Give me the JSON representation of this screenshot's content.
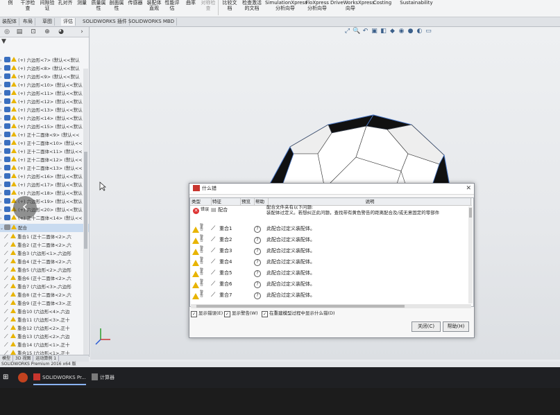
{
  "ribbon": {
    "items": [
      "例",
      "干涉检\n查",
      "间隙验\n证",
      "孔对齐",
      "测量",
      "质量属\n性",
      "剖面属\n性",
      "传感器",
      "装配体\n直观",
      "性能评\n估",
      "曲率",
      "对称检\n查",
      "比较文\n档",
      "检查激活\n的文档",
      "SimulationXpress\n分析向导",
      "FloXpress\n分析向导",
      "DriveWorksXpress\n向导",
      "Costing",
      "Sustainability"
    ]
  },
  "tabs": [
    "装配体",
    "布局",
    "草图",
    "评估",
    "SOLIDWORKS 插件",
    "SOLIDWORKS MBD"
  ],
  "active_tab": "评估",
  "tree": {
    "filter_icon": "filter-icon",
    "rows": [
      "(+) 六边形<7> (默认<<默认",
      "(+) 六边形<8> (默认<<默认",
      "(+) 六边形<9> (默认<<默认",
      "(+) 六边形<10> (默认<<默认",
      "(+) 六边形<11> (默认<<默认",
      "(+) 六边形<12> (默认<<默认",
      "(+) 六边形<13> (默认<<默认",
      "(+) 六边形<14> (默认<<默认",
      "(+) 六边形<15> (默认<<默认",
      "(+) 正十二面体<9> (默认<<",
      "(+) 正十二面体<10> (默认<<",
      "(+) 正十二面体<11> (默认<<",
      "(+) 正十二面体<12> (默认<<",
      "(+) 正十二面体<13> (默认<<",
      "(+) 六边形<16> (默认<<默认",
      "(+) 六边形<17> (默认<<默认",
      "(+) 六边形<18> (默认<<默认",
      "(+) 六边形<19> (默认<<默认",
      "(+) 六边形<20> (默认<<默认",
      "(+) 正十二面体<14> (默认<<"
    ],
    "mates_folder": "配合",
    "mates": [
      "重合1 (正十二面体<2>,六",
      "重合2 (正十二面体<2>,六",
      "重合3 (六边形<1>,六边形",
      "重合4 (正十二面体<2>,六",
      "重合5 (六边形<2>,六边形",
      "重合6 (正十二面体<2>,六",
      "重合7 (六边形<3>,六边形",
      "重合8 (正十二面体<2>,六",
      "重合9 (正十二面体<3>,正",
      "重合10 (六边形<4>,六边",
      "重合11 (六边形<3>,正十",
      "重合12 (六边形<2>,正十",
      "重合13 (六边形<2>,六边",
      "重合14 (六边形<1>,正十",
      "重合15 (六边形<1>,正十"
    ]
  },
  "bottom_tabs": [
    "模型",
    "3D 视图",
    "运动算例 1"
  ],
  "status_text": "SOLIDWORKS Premium 2016 x64 版",
  "taskbar": {
    "app1": "SOLIDWORKS Pr...",
    "app2": "计算器"
  },
  "dialog": {
    "title": "什么错",
    "columns": [
      "类型",
      "特征",
      "预览",
      "帮助",
      "说明"
    ],
    "error_row": {
      "type": "错误",
      "feature": "配合",
      "desc1": "配合文件夹有以下问题:",
      "desc2": "装配体过定义。若想纠正此问题，查找带有黄色警告的距离配合及/或无意固定的零部件"
    },
    "warning_rows": [
      {
        "type": "警告",
        "feature": "重合1",
        "desc": "此配合过定义装配体。"
      },
      {
        "type": "警告",
        "feature": "重合2",
        "desc": "此配合过定义装配体。"
      },
      {
        "type": "警告",
        "feature": "重合3",
        "desc": "此配合过定义装配体。"
      },
      {
        "type": "警告",
        "feature": "重合4",
        "desc": "此配合过定义装配体。"
      },
      {
        "type": "警告",
        "feature": "重合5",
        "desc": "此配合过定义装配体。"
      },
      {
        "type": "警告",
        "feature": "重合6",
        "desc": "此配合过定义装配体。"
      },
      {
        "type": "警告",
        "feature": "重合7",
        "desc": "此配合过定义装配体。"
      }
    ],
    "cb_errors": "显示错误(E)",
    "cb_warnings": "显示警告(W)",
    "cb_rebuild": "在重建模型过程中显示什么错(D)",
    "close_btn": "关闭(C)",
    "help_btn": "帮助(H)"
  },
  "colors": {
    "accent": "#3a6fbf",
    "warning": "#e8b400",
    "error": "#d33333"
  }
}
